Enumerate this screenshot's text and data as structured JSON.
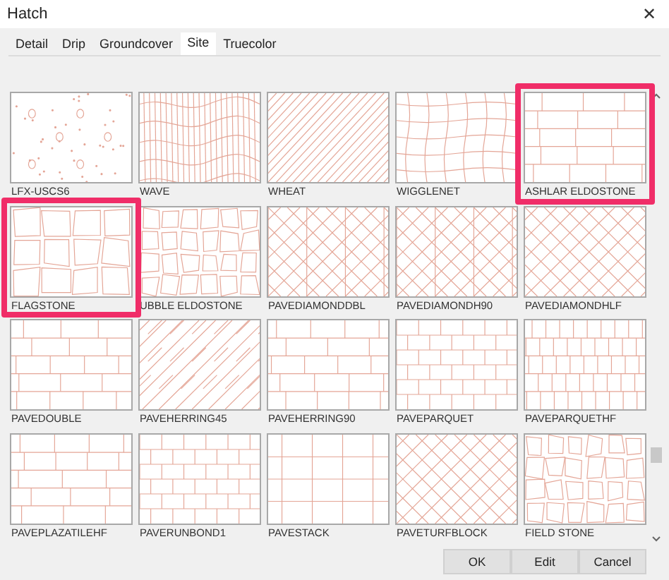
{
  "window": {
    "title": "Hatch",
    "close": "✕"
  },
  "tabs": [
    {
      "label": "Detail",
      "selected": false
    },
    {
      "label": "Drip",
      "selected": false
    },
    {
      "label": "Groundcover",
      "selected": false
    },
    {
      "label": "Site",
      "selected": true
    },
    {
      "label": "Truecolor",
      "selected": false
    }
  ],
  "hatches": [
    {
      "label": "LFX-USCS6",
      "kind": "dots",
      "highlighted": false
    },
    {
      "label": "WAVE",
      "kind": "wave",
      "highlighted": false
    },
    {
      "label": "WHEAT",
      "kind": "diagonal",
      "highlighted": false
    },
    {
      "label": "WIGGLENET",
      "kind": "wiggle",
      "highlighted": false
    },
    {
      "label": "ASHLAR ELDOSTONE",
      "kind": "ashlar",
      "highlighted": true
    },
    {
      "label": "FLAGSTONE",
      "kind": "flagstone",
      "highlighted": true
    },
    {
      "label": "UBBLE ELDOSTONE",
      "kind": "rubble",
      "highlighted": false
    },
    {
      "label": "PAVEDIAMONDDBL",
      "kind": "octagon",
      "highlighted": false
    },
    {
      "label": "PAVEDIAMONDH90",
      "kind": "octagon",
      "highlighted": false
    },
    {
      "label": "PAVEDIAMONDHLF",
      "kind": "lattice",
      "highlighted": false
    },
    {
      "label": "PAVEDOUBLE",
      "kind": "blocks",
      "highlighted": false
    },
    {
      "label": "PAVEHERRING45",
      "kind": "herring",
      "highlighted": false
    },
    {
      "label": "PAVEHERRING90",
      "kind": "blocks",
      "highlighted": false
    },
    {
      "label": "PAVEPARQUET",
      "kind": "bond",
      "highlighted": false
    },
    {
      "label": "PAVEPARQUETHF",
      "kind": "parquet",
      "highlighted": false
    },
    {
      "label": "PAVEPLAZATILEHF",
      "kind": "blocks",
      "highlighted": false
    },
    {
      "label": "PAVERUNBOND1",
      "kind": "bond",
      "highlighted": false
    },
    {
      "label": "PAVESTACK",
      "kind": "stack",
      "highlighted": false
    },
    {
      "label": "PAVETURFBLOCK",
      "kind": "lattice",
      "highlighted": false
    },
    {
      "label": "FIELD STONE",
      "kind": "rubble",
      "highlighted": false
    }
  ],
  "buttons": [
    "OK",
    "Edit",
    "Cancel"
  ]
}
